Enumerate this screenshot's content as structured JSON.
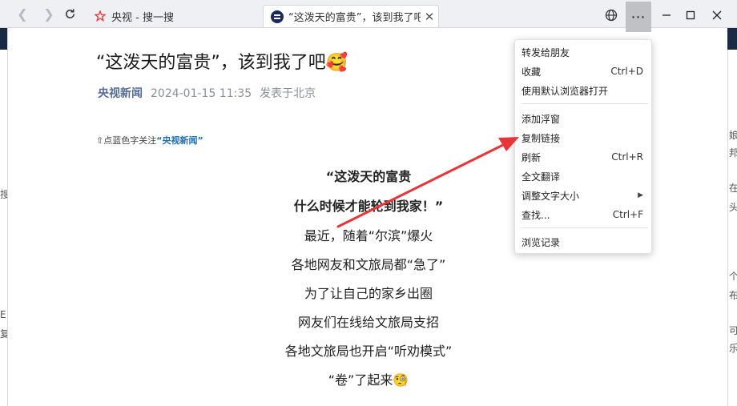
{
  "browser": {
    "tabs": [
      {
        "title": "央视 - 搜一搜",
        "active": false
      },
      {
        "title": "“这泼天的富贵”，该到我了吧😊",
        "active": true
      }
    ],
    "icons": {
      "back": "back-arrow-icon",
      "forward": "forward-arrow-icon",
      "refresh": "refresh-icon",
      "globe": "globe-icon",
      "more": "more-dots-icon"
    }
  },
  "article": {
    "title": "“这泼天的富贵”，该到我了吧🥰",
    "source": "央视新闻",
    "datetime": "2024-01-15 11:35",
    "location": "发表于北京",
    "follow_prefix": "⇧点蓝色字关注",
    "follow_link": "“央视新闻”",
    "lines": [
      "“这泼天的富贵",
      "什么时候才能轮到我家！”",
      "最近，随着“尔滨”爆火",
      "各地网友和文旅局都“急了”",
      "为了让自己的家乡出圈",
      "网友们在线给文旅局支招",
      "各地文旅局也开启“听劝模式”",
      "“卷”了起来🧐"
    ]
  },
  "context_menu": {
    "items": [
      {
        "label": "转发给朋友",
        "shortcut": ""
      },
      {
        "label": "收藏",
        "shortcut": "Ctrl+D"
      },
      {
        "label": "使用默认浏览器打开",
        "shortcut": ""
      },
      {
        "label": "添加浮窗",
        "shortcut": ""
      },
      {
        "label": "复制链接",
        "shortcut": ""
      },
      {
        "label": "刷新",
        "shortcut": "Ctrl+R"
      },
      {
        "label": "全文翻译",
        "shortcut": ""
      },
      {
        "label": "调整文字大小",
        "shortcut": "▶"
      },
      {
        "label": "查找...",
        "shortcut": "Ctrl+F"
      },
      {
        "label": "浏览记录",
        "shortcut": ""
      }
    ]
  },
  "background": {
    "left_fragments": [
      "搜",
      "E",
      "复"
    ],
    "right_fragments": [
      "娘",
      "邦",
      "在",
      "头",
      "个",
      "布",
      "可",
      "乐"
    ]
  },
  "colors": {
    "accent_red": "#e8353a",
    "source_blue": "#576b95",
    "link_blue": "#1f6fb2",
    "menu_button_bg": "#bfc1c4"
  }
}
